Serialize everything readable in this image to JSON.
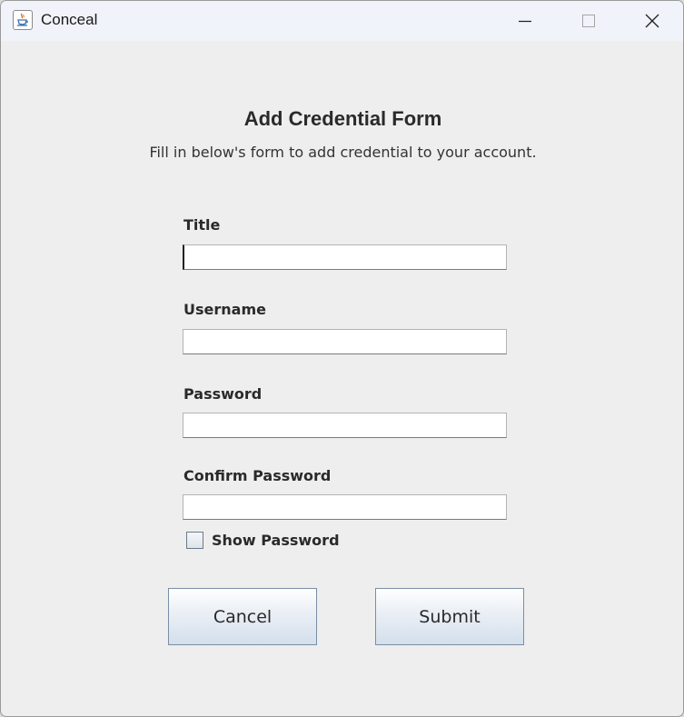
{
  "window": {
    "title": "Conceal",
    "icon": "java-cup-icon",
    "controls": [
      "minimize-icon",
      "maximize-icon",
      "close-icon"
    ]
  },
  "form": {
    "heading": "Add Credential Form",
    "subtitle": "Fill in below's form to add credential to your account.",
    "fields": [
      {
        "label": "Title",
        "value": "",
        "focused": true
      },
      {
        "label": "Username",
        "value": ""
      },
      {
        "label": "Password",
        "value": ""
      },
      {
        "label": "Confirm Password",
        "value": ""
      }
    ],
    "show_password": {
      "label": "Show Password",
      "checked": false
    }
  },
  "buttons": {
    "cancel": "Cancel",
    "submit": "Submit"
  },
  "colors": {
    "window_bg": "#eeeeee",
    "titlebar_bg": "#f0f3f9",
    "button_border": "#7a8ea6"
  }
}
